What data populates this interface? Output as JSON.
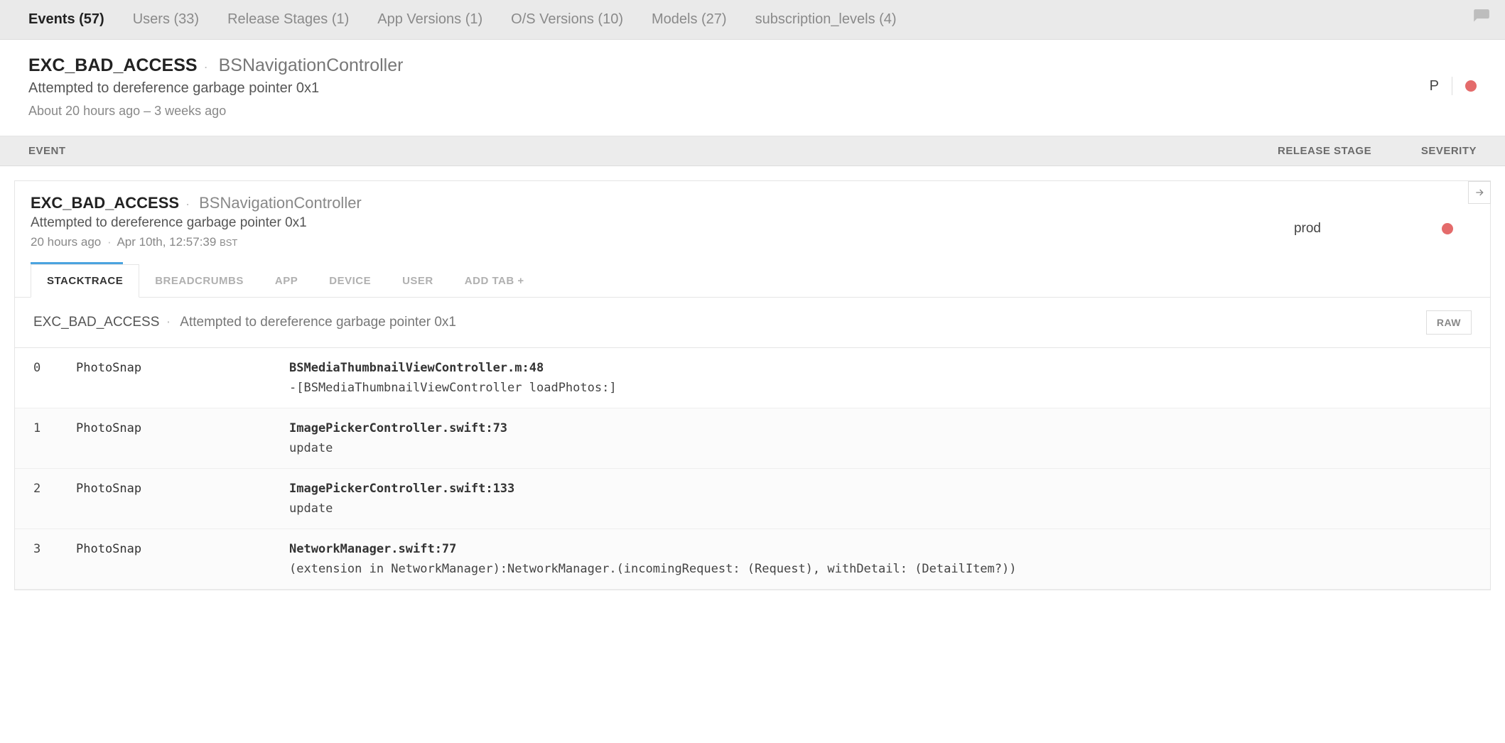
{
  "topTabs": [
    {
      "label": "Events (57)",
      "active": true
    },
    {
      "label": "Users (33)",
      "active": false
    },
    {
      "label": "Release Stages (1)",
      "active": false
    },
    {
      "label": "App Versions (1)",
      "active": false
    },
    {
      "label": "O/S Versions (10)",
      "active": false
    },
    {
      "label": "Models (27)",
      "active": false
    },
    {
      "label": "subscription_levels (4)",
      "active": false
    }
  ],
  "header": {
    "errorClass": "EXC_BAD_ACCESS",
    "context": "BSNavigationController",
    "message": "Attempted to dereference garbage pointer 0x1",
    "timeRange": "About 20 hours ago – 3 weeks ago",
    "badge": "P"
  },
  "columnsHeader": {
    "event": "EVENT",
    "stage": "RELEASE STAGE",
    "severity": "SEVERITY"
  },
  "event": {
    "errorClass": "EXC_BAD_ACCESS",
    "context": "BSNavigationController",
    "message": "Attempted to dereference garbage pointer 0x1",
    "timeAgo": "20 hours ago",
    "timestamp": "Apr 10th, 12:57:39",
    "tz": "BST",
    "releaseStage": "prod",
    "severityColor": "#e46b6b"
  },
  "subTabs": [
    {
      "label": "STACKTRACE",
      "active": true
    },
    {
      "label": "BREADCRUMBS",
      "active": false
    },
    {
      "label": "APP",
      "active": false
    },
    {
      "label": "DEVICE",
      "active": false
    },
    {
      "label": "USER",
      "active": false
    },
    {
      "label": "ADD TAB +",
      "active": false
    }
  ],
  "trace": {
    "name": "EXC_BAD_ACCESS",
    "message": "Attempted to dereference garbage pointer 0x1",
    "rawLabel": "RAW",
    "frames": [
      {
        "idx": "0",
        "module": "PhotoSnap",
        "file": "BSMediaThumbnailViewController.m:48",
        "fn": "-[BSMediaThumbnailViewController loadPhotos:]"
      },
      {
        "idx": "1",
        "module": "PhotoSnap",
        "file": "ImagePickerController.swift:73",
        "fn": "update"
      },
      {
        "idx": "2",
        "module": "PhotoSnap",
        "file": "ImagePickerController.swift:133",
        "fn": "update"
      },
      {
        "idx": "3",
        "module": "PhotoSnap",
        "file": "NetworkManager.swift:77",
        "fn": "(extension in NetworkManager):NetworkManager.(incomingRequest: (Request), withDetail: (DetailItem?))"
      }
    ]
  }
}
